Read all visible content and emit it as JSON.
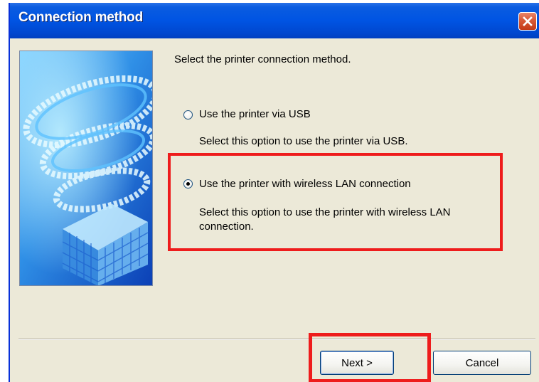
{
  "window": {
    "title": "Connection method"
  },
  "instruction": "Select the printer connection method.",
  "options": [
    {
      "label": "Use the printer via USB",
      "description": "Select this option to use the printer via USB.",
      "selected": false
    },
    {
      "label": "Use the printer with wireless LAN connection",
      "description_line1": "Select this option to use the printer with wireless LAN",
      "description_line2": "connection.",
      "selected": true
    }
  ],
  "buttons": {
    "next": "Next >",
    "cancel": "Cancel"
  },
  "colors": {
    "titlebar": "#0054e3",
    "dialog_bg": "#ece9d8",
    "highlight": "#ee1c1c"
  }
}
